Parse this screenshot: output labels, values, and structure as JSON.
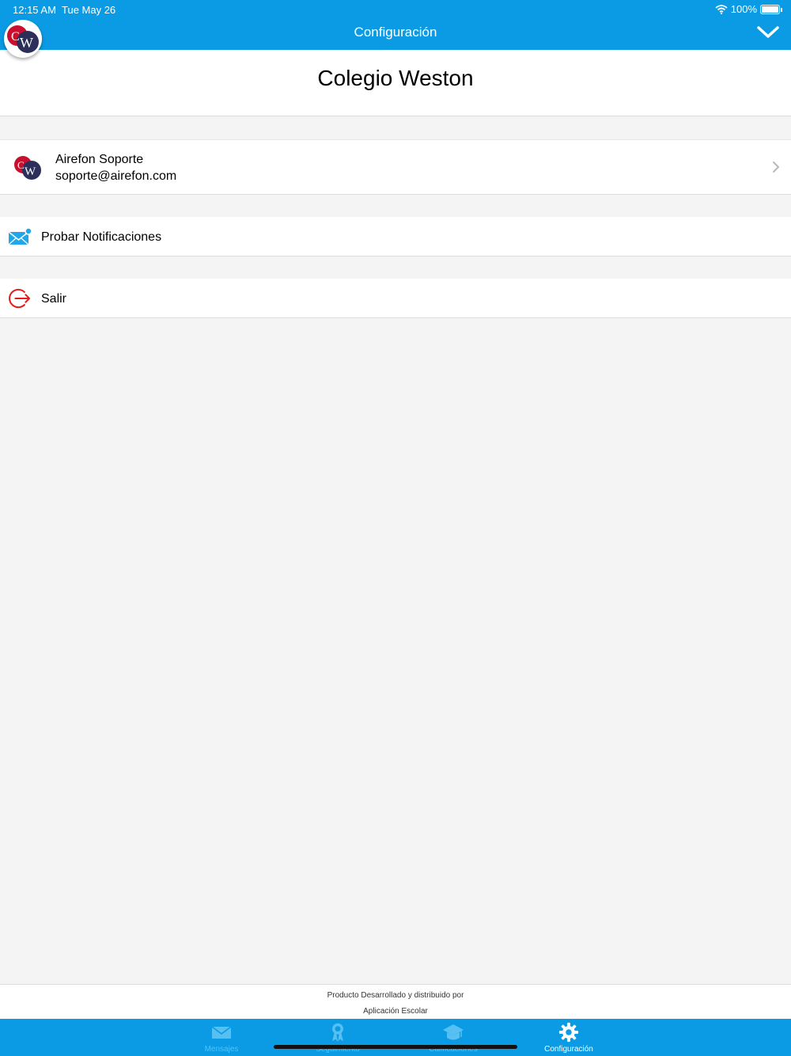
{
  "status_bar": {
    "time": "12:15 AM",
    "date": "Tue May 26",
    "battery": "100%"
  },
  "nav": {
    "title": "Configuración"
  },
  "school": {
    "name": "Colegio Weston"
  },
  "user": {
    "name": "Airefon Soporte",
    "email": "soporte@airefon.com"
  },
  "actions": {
    "test_notifications": "Probar Notificaciones",
    "exit": "Salir"
  },
  "footer": {
    "line1": "Producto Desarrollado y distribuido por",
    "line2": "Aplicación Escolar"
  },
  "tabs": [
    {
      "label": "Mensajes",
      "icon": "mail-icon"
    },
    {
      "label": "Seguimiento",
      "icon": "award-icon"
    },
    {
      "label": "Calificaciones",
      "icon": "graduation-cap-icon"
    },
    {
      "label": "Configuración",
      "icon": "gear-icon"
    }
  ],
  "active_tab": "Configuración",
  "colors": {
    "primary": "#0b9be4",
    "tab_inactive": "#56c0f3",
    "logo_red": "#c8102e",
    "logo_navy": "#2b2f5a",
    "exit_red": "#e02020",
    "notif_blue": "#21a7e8"
  }
}
